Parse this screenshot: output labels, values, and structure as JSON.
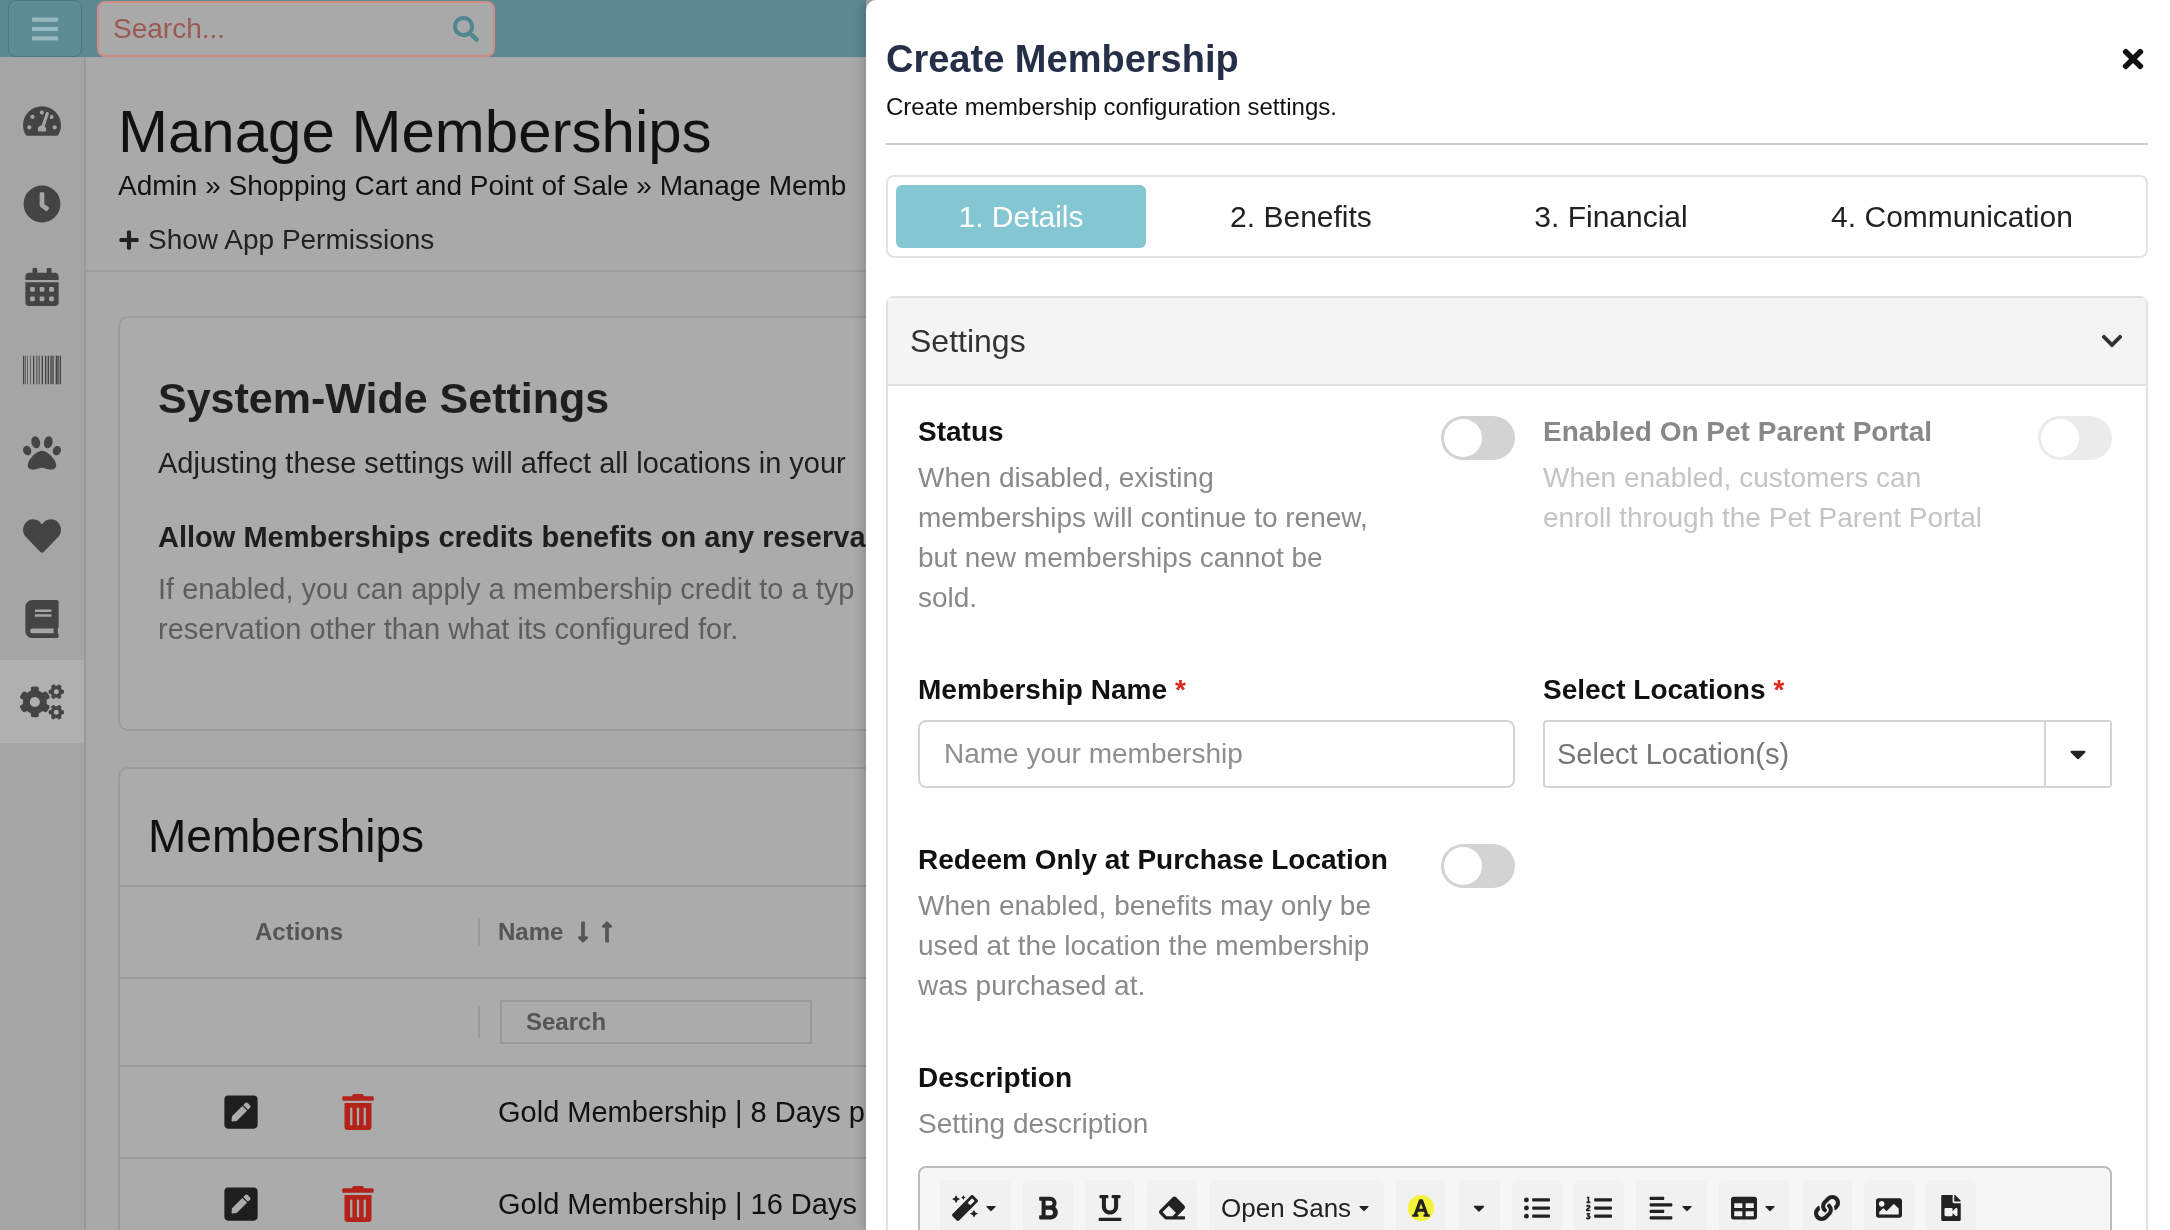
{
  "topbar": {
    "search": {
      "placeholder": "Search..."
    }
  },
  "sidebar": {
    "items": [
      {
        "selected": false
      },
      {
        "selected": false
      },
      {
        "selected": false
      },
      {
        "selected": false
      },
      {
        "selected": false
      },
      {
        "selected": false
      },
      {
        "selected": false
      },
      {
        "selected": true
      }
    ]
  },
  "page": {
    "title": "Manage Memberships",
    "breadcrumb": "Admin » Shopping Cart and Point of Sale » Manage Memb",
    "permissions_link": "Show App Permissions"
  },
  "system_settings": {
    "title": "System-Wide Settings",
    "description": "Adjusting these settings will affect all locations in your",
    "setting_label": "Allow Memberships credits benefits on any reserva",
    "help_lines": [
      "If enabled, you can apply a membership credit to a typ",
      "reservation other than what its configured for."
    ]
  },
  "memberships": {
    "title": "Memberships",
    "columns": [
      {
        "label": "Actions",
        "sortable": false
      },
      {
        "label": "Name",
        "sortable": true
      }
    ],
    "name_filter": {
      "placeholder": "Search"
    },
    "rows": [
      {
        "name": "Gold Membership | 8 Days p"
      },
      {
        "name": "Gold Membership | 16 Days"
      }
    ]
  },
  "drawer": {
    "title": "Create Membership",
    "subtitle": "Create membership configuration settings.",
    "tabs": [
      {
        "label": "1. Details",
        "selected": true
      },
      {
        "label": "2. Benefits",
        "selected": false
      },
      {
        "label": "3. Financial",
        "selected": false
      },
      {
        "label": "4. Communication",
        "selected": false
      }
    ],
    "section": {
      "title": "Settings",
      "expanded": true,
      "fields": [
        {
          "kind": "toggle",
          "label": "Status",
          "help": "When disabled, existing memberships will continue to renew, but new memberships cannot be sold.",
          "on": false,
          "disabled": false
        },
        {
          "kind": "toggle",
          "label": "Enabled On Pet Parent Portal",
          "help": "When enabled, customers can enroll through the Pet Parent Portal",
          "on": false,
          "disabled": true
        },
        {
          "kind": "text",
          "label": "Membership Name",
          "required": true,
          "required_mark": "*",
          "placeholder": "Name your membership"
        },
        {
          "kind": "select",
          "label": "Select Locations",
          "required": true,
          "required_mark": "*",
          "placeholder": "Select Location(s)"
        },
        {
          "kind": "toggle",
          "label": "Redeem Only at Purchase Location",
          "help": "When enabled, benefits may only be used at the location the membership was purchased at.",
          "on": false,
          "disabled": false
        },
        {
          "kind": "editor",
          "label": "Description",
          "help": "Setting description",
          "font_name": "Open Sans"
        }
      ]
    }
  }
}
